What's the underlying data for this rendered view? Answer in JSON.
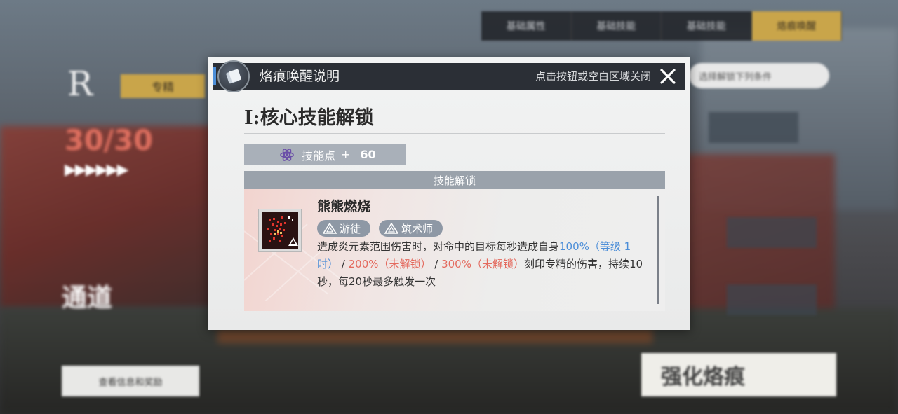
{
  "background": {
    "tabs": [
      "基础属性",
      "基础技能",
      "基础技能",
      "烙痕唤醒"
    ],
    "active_tab_index": 3,
    "rarity": "R",
    "badge_label": "专精",
    "level": "30/30",
    "title": "通道",
    "info_button": "查看信息和奖励",
    "search_placeholder": "选择解锁下列条件",
    "strengthen_button": "强化烙痕"
  },
  "modal": {
    "header_title": "烙痕唤醒说明",
    "close_hint": "点击按钮或空白区域关闭",
    "section_title": "I:核心技能解锁",
    "points_label": "技能点",
    "points_op": "+",
    "points_value": "60",
    "unlock_header": "技能解锁",
    "skill": {
      "name": "熊熊燃烧",
      "tags": [
        "游徒",
        "筑术师"
      ],
      "desc_1": "造成炎元素范围伤害时，对命中的目标每秒造成自身",
      "pct_1": "100%（等级 1时）",
      "sep_1": " / ",
      "pct_2": "200%（未解锁）",
      "sep_2": " / ",
      "pct_3": "300%（未解锁）",
      "desc_2": "刻印专精的伤害，持续10秒，每20秒最多触发一次"
    }
  },
  "colors": {
    "accent_blue": "#4c8ed8",
    "locked_red": "#e46a5e",
    "header_dark": "#2b2f36",
    "gold": "#c9a54a"
  }
}
